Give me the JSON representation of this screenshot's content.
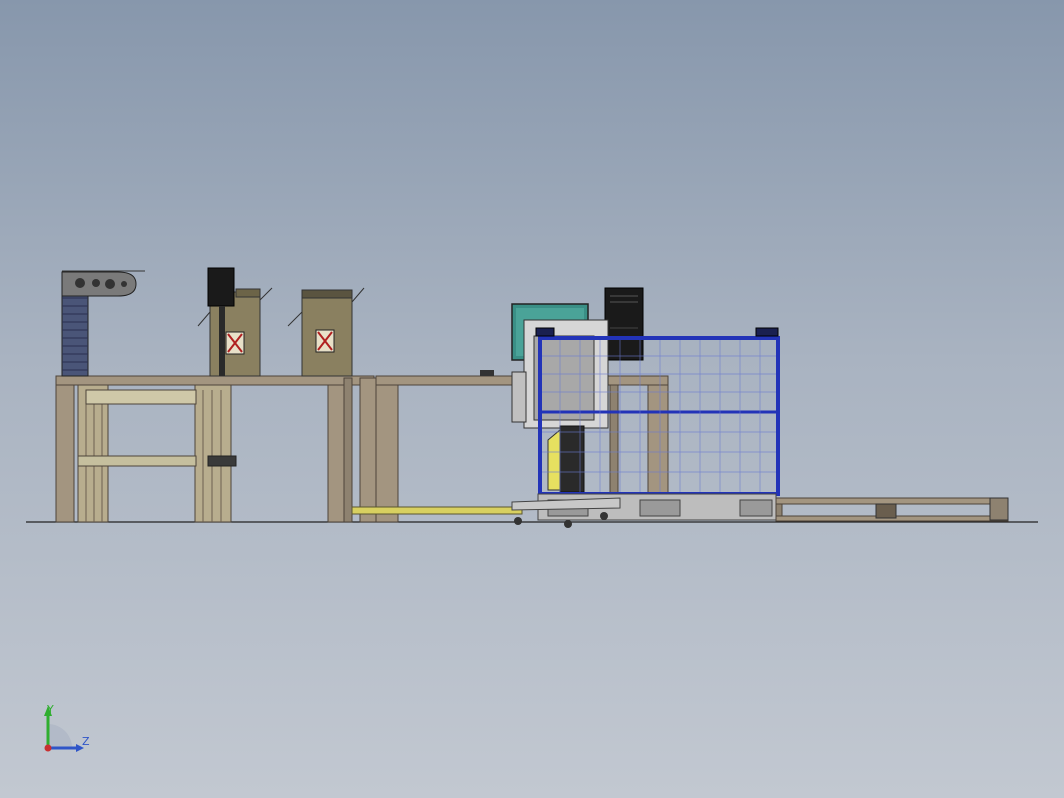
{
  "viewport": {
    "background_top": "#8797ac",
    "background_bottom": "#c2c8d1"
  },
  "triad": {
    "y_label": "Y",
    "z_label": "Z",
    "y_color": "#2fae2f",
    "z_color": "#2f55c8",
    "origin_color": "#c83030"
  },
  "colors": {
    "table_wood": "#a39580",
    "table_edge": "#5a5044",
    "box_olive": "#8a8060",
    "guard_blue": "#2233b8",
    "rail_yellow": "#d8d060",
    "monitor_teal": "#3a8f86",
    "tower_black": "#1a1a1a"
  }
}
